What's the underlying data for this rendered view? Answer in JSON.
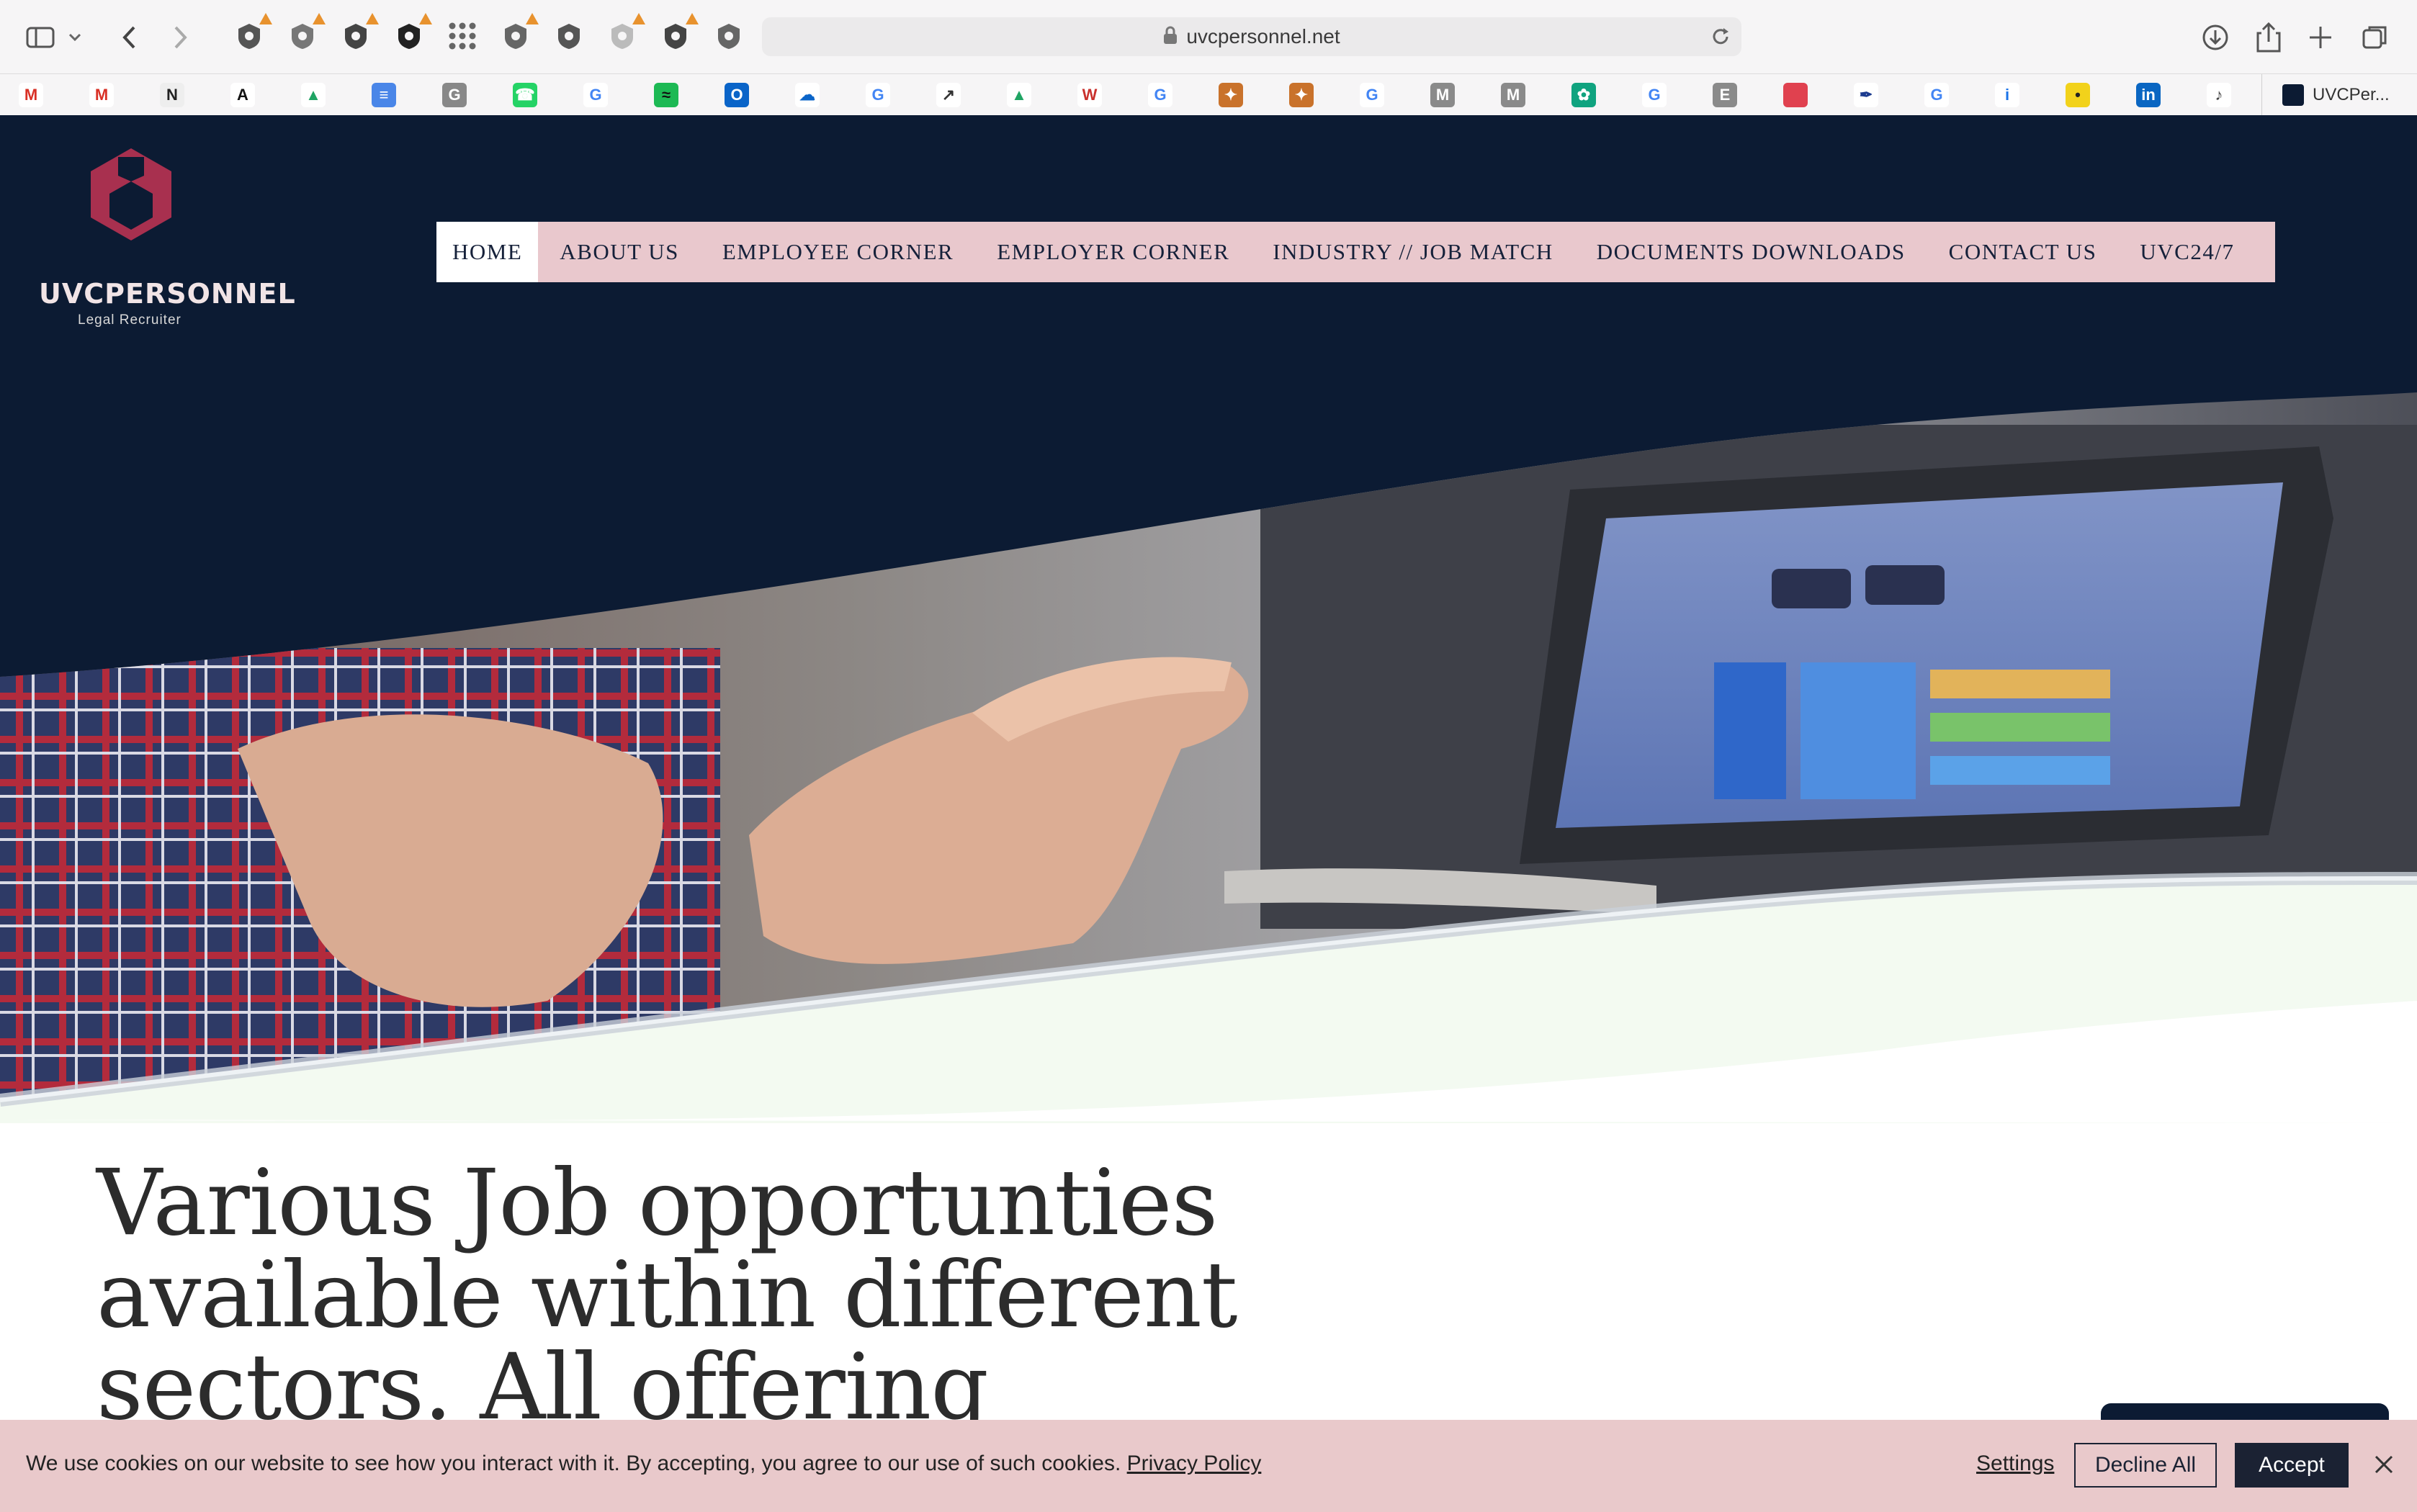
{
  "browser": {
    "url": "uvcpersonnel.net",
    "tab_title": "UVCPer...",
    "extension_icons": [
      "shield-warning-icon",
      "grammarly-icon",
      "pickaxe-icon",
      "timer-icon",
      "grid-apps-icon",
      "video-icon",
      "shield-icon",
      "shield-light-icon",
      "shield-dark-icon",
      "shield-outline-icon"
    ],
    "bookmark_icons": [
      "gmail-icon",
      "gmail-icon",
      "nyt-icon",
      "font-icon",
      "drive-icon",
      "docs-icon",
      "g-icon",
      "whatsapp-icon",
      "google-icon",
      "spotify-icon",
      "outlook-icon",
      "onedrive-icon",
      "google-icon",
      "stocks-icon",
      "drive-icon",
      "w-icon",
      "google-icon",
      "crest-icon",
      "crest-icon",
      "google-icon",
      "m-icon",
      "m-icon",
      "chatgpt-icon",
      "google-icon",
      "e-icon",
      "red-square-icon",
      "pen-icon",
      "google-icon",
      "info-icon",
      "yellow-icon",
      "linkedin-icon",
      "music-icon"
    ]
  },
  "site": {
    "logo_name": "UVCPERSONNEL",
    "logo_tagline": "Legal Recruiter",
    "nav": [
      {
        "label": "HOME",
        "active": true
      },
      {
        "label": "ABOUT US",
        "active": false
      },
      {
        "label": "EMPLOYEE CORNER",
        "active": false
      },
      {
        "label": "EMPLOYER CORNER",
        "active": false
      },
      {
        "label": "INDUSTRY // JOB MATCH",
        "active": false
      },
      {
        "label": "DOCUMENTS DOWNLOADS",
        "active": false
      },
      {
        "label": "CONTACT US",
        "active": false
      },
      {
        "label": "UVC24/7",
        "active": false
      }
    ],
    "headline": "Various Job opportunties available within different sectors. All offering"
  },
  "cookie_banner": {
    "message": "We use cookies on our website to see how you interact with it. By accepting, you agree to our use of such cookies.",
    "privacy_link": "Privacy Policy",
    "settings_label": "Settings",
    "decline_label": "Decline All",
    "accept_label": "Accept"
  },
  "colors": {
    "navy": "#0c1b33",
    "rose": "#e9c8cd",
    "logo_red": "#a8304f",
    "mint": "#f3faf1"
  }
}
